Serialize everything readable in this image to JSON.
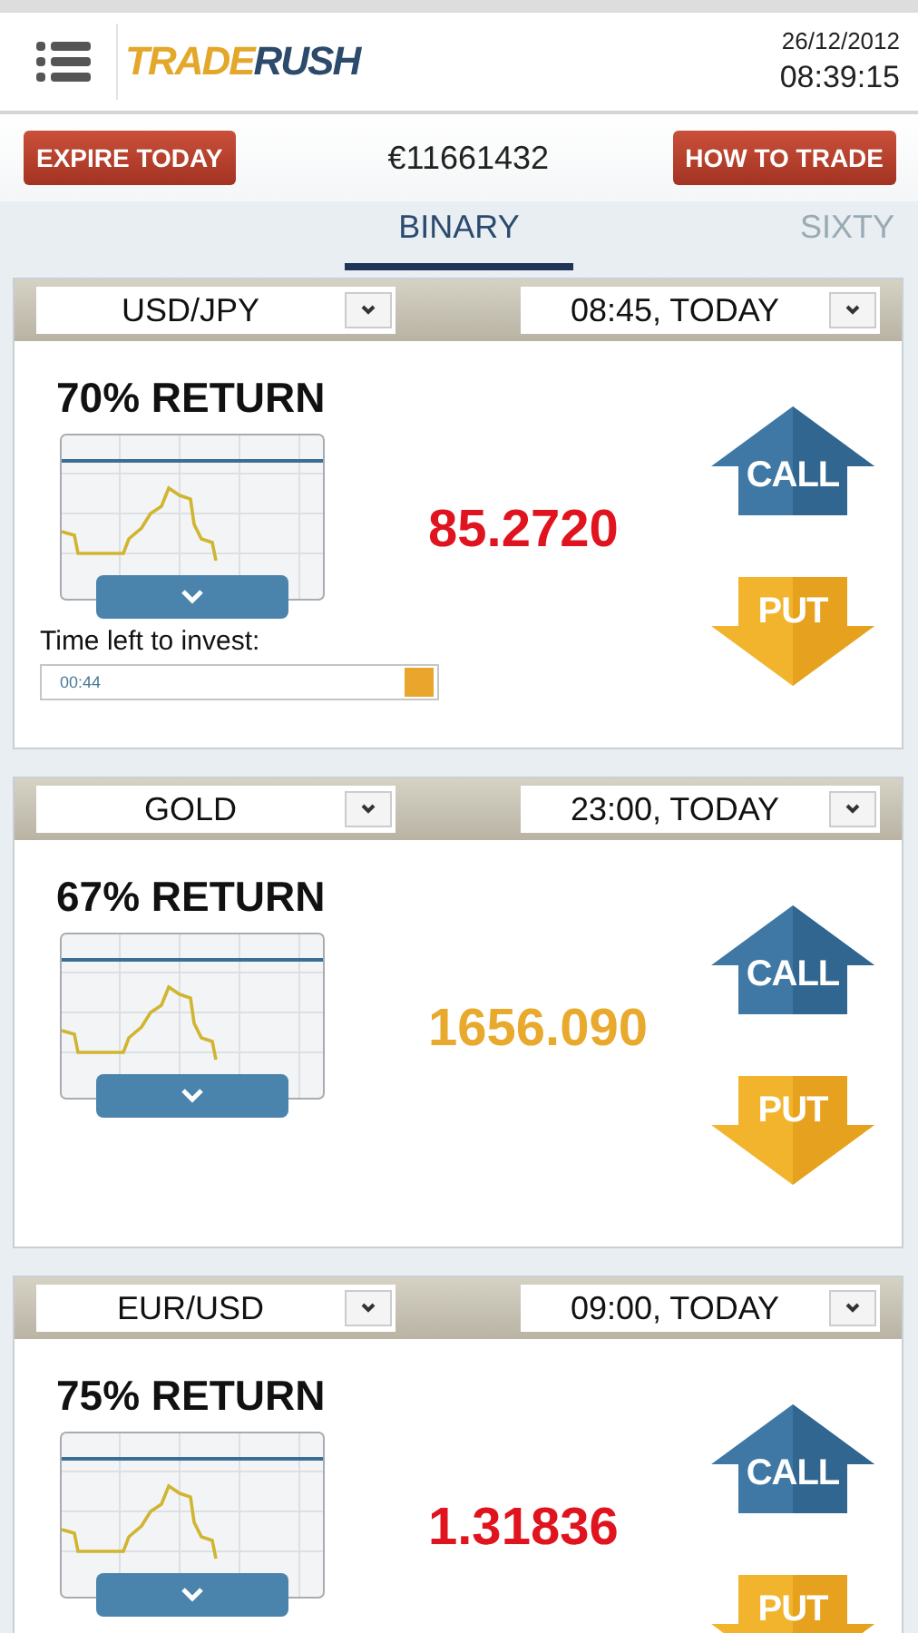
{
  "header": {
    "logo_parts": [
      "TRADE",
      "RUSH"
    ],
    "date": "26/12/2012",
    "time": "08:39:15"
  },
  "action_bar": {
    "left_button": "EXPIRE TODAY",
    "balance": "€11661432",
    "right_button": "HOW TO TRADE"
  },
  "tabs": [
    {
      "label": "BINARY",
      "selected": true
    },
    {
      "label": "SIXTY",
      "selected": false
    }
  ],
  "cards": [
    {
      "asset": "USD/JPY",
      "expiry": "08:45, TODAY",
      "return": "70% RETURN",
      "price": "85.2720",
      "color": "#e0141e",
      "call": "CALL",
      "put": "PUT",
      "timer": {
        "label": "Time left to invest:",
        "value": "00:44"
      }
    },
    {
      "asset": "GOLD",
      "expiry": "23:00, TODAY",
      "return": "67% RETURN",
      "price": "1656.090",
      "color": "#e8a92c",
      "call": "CALL",
      "put": "PUT"
    },
    {
      "asset": "EUR/USD",
      "expiry": "09:00, TODAY",
      "return": "75% RETURN",
      "price": "1.31836",
      "color": "#e0141e",
      "call": "CALL",
      "put": "PUT"
    }
  ]
}
